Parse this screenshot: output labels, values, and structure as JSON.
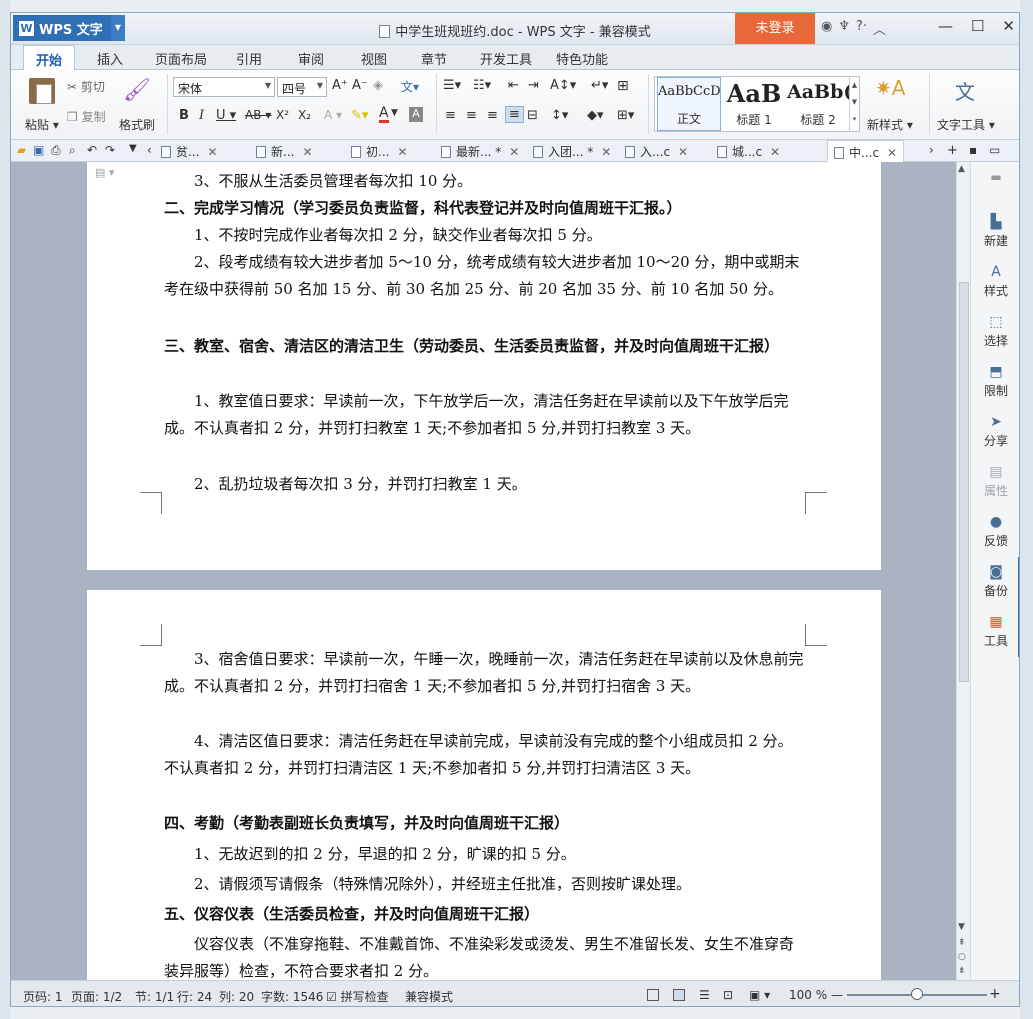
{
  "window": {
    "app_name": "WPS 文字",
    "logo_letter": "W",
    "doc_title": "中学生班规班约.doc - WPS 文字 - 兼容模式",
    "login": "未登录"
  },
  "ribbon_tabs": [
    "开始",
    "插入",
    "页面布局",
    "引用",
    "审阅",
    "视图",
    "章节",
    "开发工具",
    "特色功能"
  ],
  "ribbon": {
    "paste": "粘贴",
    "cut": "剪切",
    "copy": "复制",
    "format_painter": "格式刷",
    "font_name": "宋体",
    "font_size": "四号",
    "styles": [
      {
        "preview": "AaBbCcD",
        "label": "正文"
      },
      {
        "preview": "AaB",
        "label": "标题 1"
      },
      {
        "preview": "AaBb(",
        "label": "标题 2"
      }
    ],
    "new_style": "新样式",
    "text_tools": "文字工具"
  },
  "doc_tabs": [
    "贫...",
    "新...",
    "初...",
    "最新... *",
    "入团... *",
    "入...c",
    "城...c",
    "中...c"
  ],
  "document": {
    "page1": [
      {
        "text": "3、不服从生活委员管理者每次扣 10 分。",
        "style": "ind"
      },
      {
        "text": "二、完成学习情况（学习委员负责监督，科代表登记并及时向值周班干汇报。）",
        "style": "bold"
      },
      {
        "text": "1、不按时完成作业者每次扣 2 分，缺交作业者每次扣 5 分。",
        "style": "ind"
      },
      {
        "text": "2、段考成绩有较大进步者加 5～10 分，统考成绩有较大进步者加 10～20 分，期中或期末考在级中获得前 50 名加 15 分、前 30 名加 25 分、前 20 名加 35 分、前 10 名加 50 分。",
        "style": "ind"
      },
      {
        "text": "三、教室、宿舍、清洁区的清洁卫生（劳动委员、生活委员责监督，并及时向值周班干汇报）",
        "style": "bold"
      },
      {
        "text": "1、教室值日要求：早读前一次，下午放学后一次，清洁任务赶在早读前以及下午放学后完成。不认真者扣 2 分，并罚打扫教室 1 天;不参加者扣 5 分,并罚打扫教室 3 天。",
        "style": "ind"
      },
      {
        "text": "2、乱扔垃圾者每次扣 3 分，并罚打扫教室 1 天。",
        "style": "ind"
      }
    ],
    "page2": [
      {
        "text": "3、宿舍值日要求：早读前一次，午睡一次，晚睡前一次，清洁任务赶在早读前以及休息前完成。不认真者扣 2 分，并罚打扫宿舍 1 天;不参加者扣 5 分,并罚打扫宿舍 3 天。",
        "style": "ind"
      },
      {
        "text": "4、清洁区值日要求：清洁任务赶在早读前完成，早读前没有完成的整个小组成员扣 2 分。不认真者扣 2 分，并罚打扫清洁区 1 天;不参加者扣 5 分,并罚打扫清洁区 3 天。",
        "style": "ind"
      },
      {
        "text": "四、考勤（考勤表副班长负责填写，并及时向值周班干汇报）",
        "style": "bold"
      },
      {
        "text": "1、无故迟到的扣 2 分，早退的扣 2 分，旷课的扣 5 分。",
        "style": "ind"
      },
      {
        "text": "2、请假须写请假条（特殊情况除外），并经班主任批准，否则按旷课处理。",
        "style": "ind"
      },
      {
        "text": "五、仪容仪表（生活委员检查，并及时向值周班干汇报）",
        "style": "bold"
      },
      {
        "text": "仪容仪表（不准穿拖鞋、不准戴首饰、不准染彩发或烫发、男生不准留长发、女生不准穿奇装异服等）检查，不符合要求者扣 2 分。",
        "style": "ind"
      }
    ]
  },
  "task_panel": [
    "新建",
    "样式",
    "选择",
    "限制",
    "分享",
    "属性",
    "反馈",
    "备份",
    "工具"
  ],
  "status": {
    "page_num": "页码: 1",
    "pages": "页面: 1/2",
    "section": "节: 1/1",
    "line": "行: 24",
    "col": "列: 20",
    "word_count": "字数: 1546",
    "spell_check": "拼写检查",
    "compat_mode": "兼容模式",
    "zoom": "100 %"
  }
}
